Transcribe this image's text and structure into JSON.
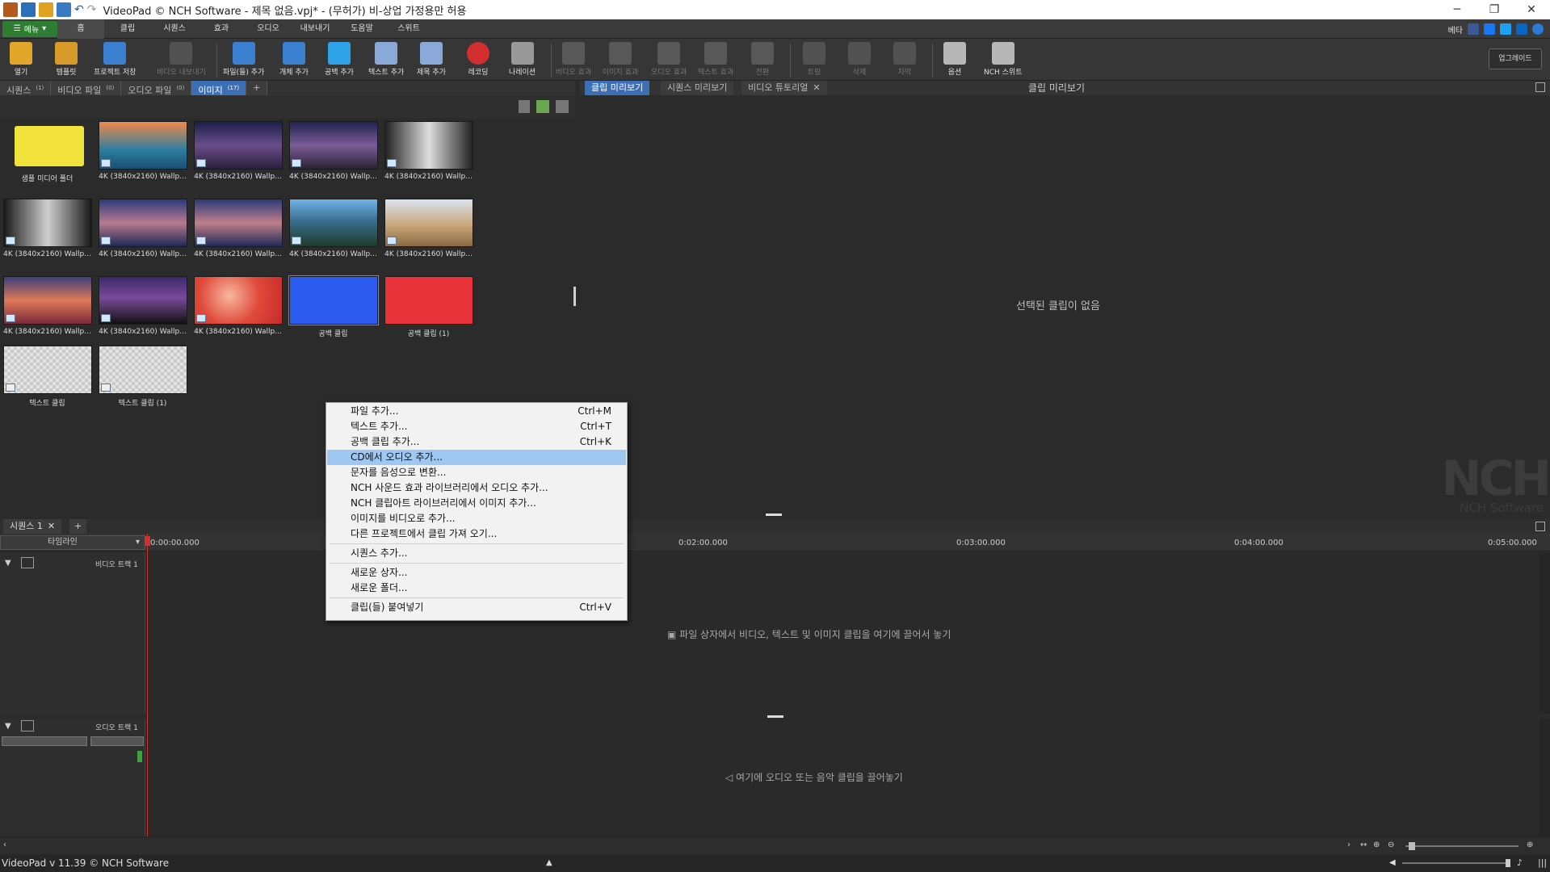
{
  "window": {
    "title": "VideoPad © NCH Software - 제목 없음.vpj* - (무허가) 비-상업 가정용만 허용"
  },
  "menubar": {
    "menu_button": "메뉴",
    "tabs": [
      "홈",
      "클립",
      "시퀀스",
      "효과",
      "오디오",
      "내보내기",
      "도움말",
      "스위트"
    ],
    "right_label": "베타"
  },
  "toolbar": {
    "buttons": [
      "열기",
      "템플릿",
      "프로젝트 저장",
      "비디오 내보내기",
      "파일(들) 추가",
      "개체 추가",
      "공백 추가",
      "텍스트 추가",
      "제목 추가",
      "레코딩",
      "나레이션",
      "비디오 효과",
      "이미지 효과",
      "오디오 효과",
      "텍스트 효과",
      "전환",
      "트림",
      "삭제",
      "자막",
      "옵션",
      "NCH 스위트"
    ],
    "upgrade": "업그레이드"
  },
  "bin": {
    "tabs": [
      {
        "label": "시퀀스",
        "count": "(1)"
      },
      {
        "label": "비디오 파일",
        "count": "(0)"
      },
      {
        "label": "오디오 파일",
        "count": "(0)"
      },
      {
        "label": "이미지",
        "count": "(17)"
      }
    ],
    "add_tab": "+",
    "items": [
      {
        "label": "샘플 미디어 폴더"
      },
      {
        "label": "4K (3840x2160) Wallp..."
      },
      {
        "label": "4K (3840x2160) Wallp..."
      },
      {
        "label": "4K (3840x2160) Wallp..."
      },
      {
        "label": "4K (3840x2160) Wallp..."
      },
      {
        "label": "4K (3840x2160) Wallp..."
      },
      {
        "label": "4K (3840x2160) Wallp..."
      },
      {
        "label": "4K (3840x2160) Wallp..."
      },
      {
        "label": "4K (3840x2160) Wallp..."
      },
      {
        "label": "4K (3840x2160) Wallp..."
      },
      {
        "label": "4K (3840x2160) Wallp..."
      },
      {
        "label": "4K (3840x2160) Wallp..."
      },
      {
        "label": "4K (3840x2160) Wallp..."
      },
      {
        "label": "공백 클립"
      },
      {
        "label": "공백 클립 (1)"
      },
      {
        "label": "텍스트 클립"
      },
      {
        "label": "텍스트 클립 (1)"
      }
    ]
  },
  "preview": {
    "tabs": [
      "클립 미리보기",
      "시퀀스 미리보기",
      "비디오 튜토리얼"
    ],
    "title": "클립 미리보기",
    "empty": "선택된 클립이 없음",
    "logo": "NCH",
    "logo_sub": "NCH Software"
  },
  "timeline": {
    "sequence_tab": "시퀀스 1",
    "mode": "타임라인",
    "ticks": [
      "0:00:00.000",
      "0:02:00.000",
      "0:03:00.000",
      "0:04:00.000",
      "0:05:00.000"
    ],
    "video_track": "비디오 트랙 1",
    "audio_track": "오디오 트랙 1",
    "video_drop": "파일 상자에서 비디오, 텍스트 및 이미지 클립을 여기에 끌어서 놓기",
    "audio_drop": "여기에 오디오 또는 음악 클립을 끌어놓기"
  },
  "context_menu": {
    "items": [
      {
        "label": "파일 추가...",
        "shortcut": "Ctrl+M"
      },
      {
        "label": "텍스트 추가...",
        "shortcut": "Ctrl+T"
      },
      {
        "label": "공백 클립 추가...",
        "shortcut": "Ctrl+K"
      },
      {
        "label": "CD에서 오디오 추가...",
        "shortcut": ""
      },
      {
        "label": "문자를 음성으로 변환...",
        "shortcut": ""
      },
      {
        "label": "NCH 사운드 효과 라이브러리에서 오디오 추가...",
        "shortcut": ""
      },
      {
        "label": "NCH 클립아트 라이브러리에서 이미지 추가...",
        "shortcut": ""
      },
      {
        "label": "이미지를 비디오로 추가...",
        "shortcut": ""
      },
      {
        "label": "다른 프로젝트에서 클립 가져 오기...",
        "shortcut": ""
      },
      {
        "label": "시퀀스 추가...",
        "shortcut": ""
      },
      {
        "label": "새로운 상자...",
        "shortcut": ""
      },
      {
        "label": "새로운 폴더...",
        "shortcut": ""
      },
      {
        "label": "클립(들) 붙여넣기",
        "shortcut": "Ctrl+V"
      }
    ]
  },
  "status": {
    "text": "VideoPad v 11.39 © NCH Software"
  },
  "colors": {
    "accent": "#3d6fb6",
    "menu_green": "#2e7d32",
    "highlight": "#9ec7f2",
    "blank_blue": "#2f5cf0",
    "blank_red": "#e8323a",
    "playhead": "#d32f2f"
  }
}
